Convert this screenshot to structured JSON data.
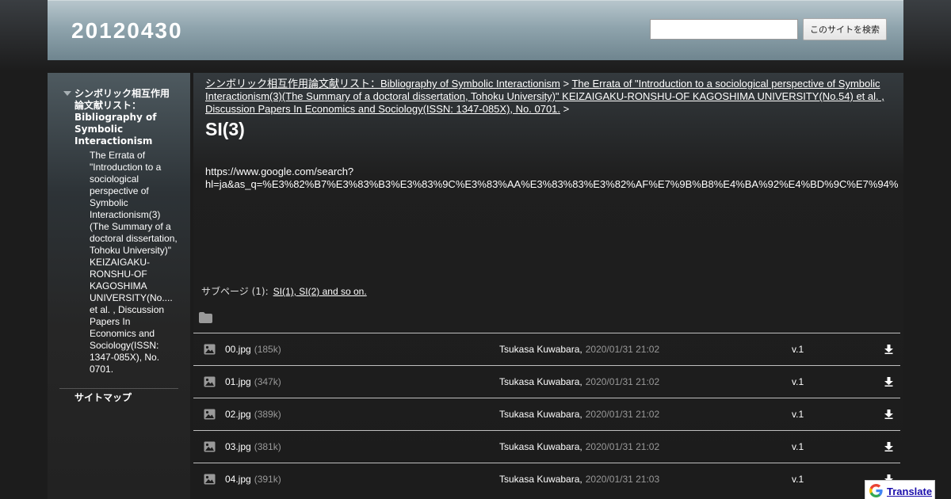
{
  "header": {
    "site_title": "20120430",
    "search_placeholder": "",
    "search_button": "このサイトを検索"
  },
  "sidebar": {
    "top_item": "シンボリック相互作用論文献リスト：Bibliography of Symbolic Interactionism",
    "sub_item": "The Errata of \"Introduction to a sociological perspective of Symbolic Interactionism(3)(The Summary of a doctoral dissertation, Tohoku University)\" KEIZAIGAKU-RONSHU-OF KAGOSHIMA UNIVERSITY(No.... et al. , Discussion Papers In Economics and Sociology(ISSN: 1347-085X), No. 0701.",
    "sitemap": "サイトマップ"
  },
  "breadcrumb": {
    "link1": "シンボリック相互作用論文献リスト：Bibliography of Symbolic Interactionism",
    "sep1": " > ",
    "link2": "The Errata of \"Introduction to a sociological perspective of Symbolic Interactionism(3)(The Summary of a doctoral dissertation, Tohoku University)\" KEIZAIGAKU-RONSHU-OF KAGOSHIMA UNIVERSITY(No.54) et al. , Discussion Papers In Economics and Sociology(ISSN: 1347-085X), No. 0701.",
    "sep2": " >"
  },
  "page": {
    "title": "SI(3)",
    "url_line1": "https://www.google.com/search?",
    "url_line2": "hl=ja&as_q=%E3%82%B7%E3%83%B3%E3%83%9C%E3%83%AA%E3%83%83%E3%82%AF%E7%9B%B8%E4%BA%92%E4%BD%9C%E7%94%"
  },
  "subpages": {
    "label": "サブページ (1):",
    "link": "SI(1), SI(2) and so on."
  },
  "files": [
    {
      "name": "00.jpg",
      "size": "(185k)",
      "owner": "Tsukasa Kuwabara,",
      "date": "2020/01/31 21:02",
      "version": "v.1"
    },
    {
      "name": "01.jpg",
      "size": "(347k)",
      "owner": "Tsukasa Kuwabara,",
      "date": "2020/01/31 21:02",
      "version": "v.1"
    },
    {
      "name": "02.jpg",
      "size": "(389k)",
      "owner": "Tsukasa Kuwabara,",
      "date": "2020/01/31 21:02",
      "version": "v.1"
    },
    {
      "name": "03.jpg",
      "size": "(381k)",
      "owner": "Tsukasa Kuwabara,",
      "date": "2020/01/31 21:02",
      "version": "v.1"
    },
    {
      "name": "04.jpg",
      "size": "(391k)",
      "owner": "Tsukasa Kuwabara,",
      "date": "2020/01/31 21:03",
      "version": "v.1"
    }
  ],
  "translate": {
    "label": "Translate"
  },
  "icons": {
    "folder": "folder-icon",
    "image": "image-file-icon",
    "download": "download-arrow-icon",
    "expand": "triangle-down-icon",
    "google": "google-g-icon"
  },
  "colors": {
    "header_gradient_top": "#b7c6cc",
    "header_gradient_bottom": "#6f858f",
    "background": "#1c1c1c",
    "muted_text": "#999999",
    "translate_link": "#1a0dab"
  }
}
